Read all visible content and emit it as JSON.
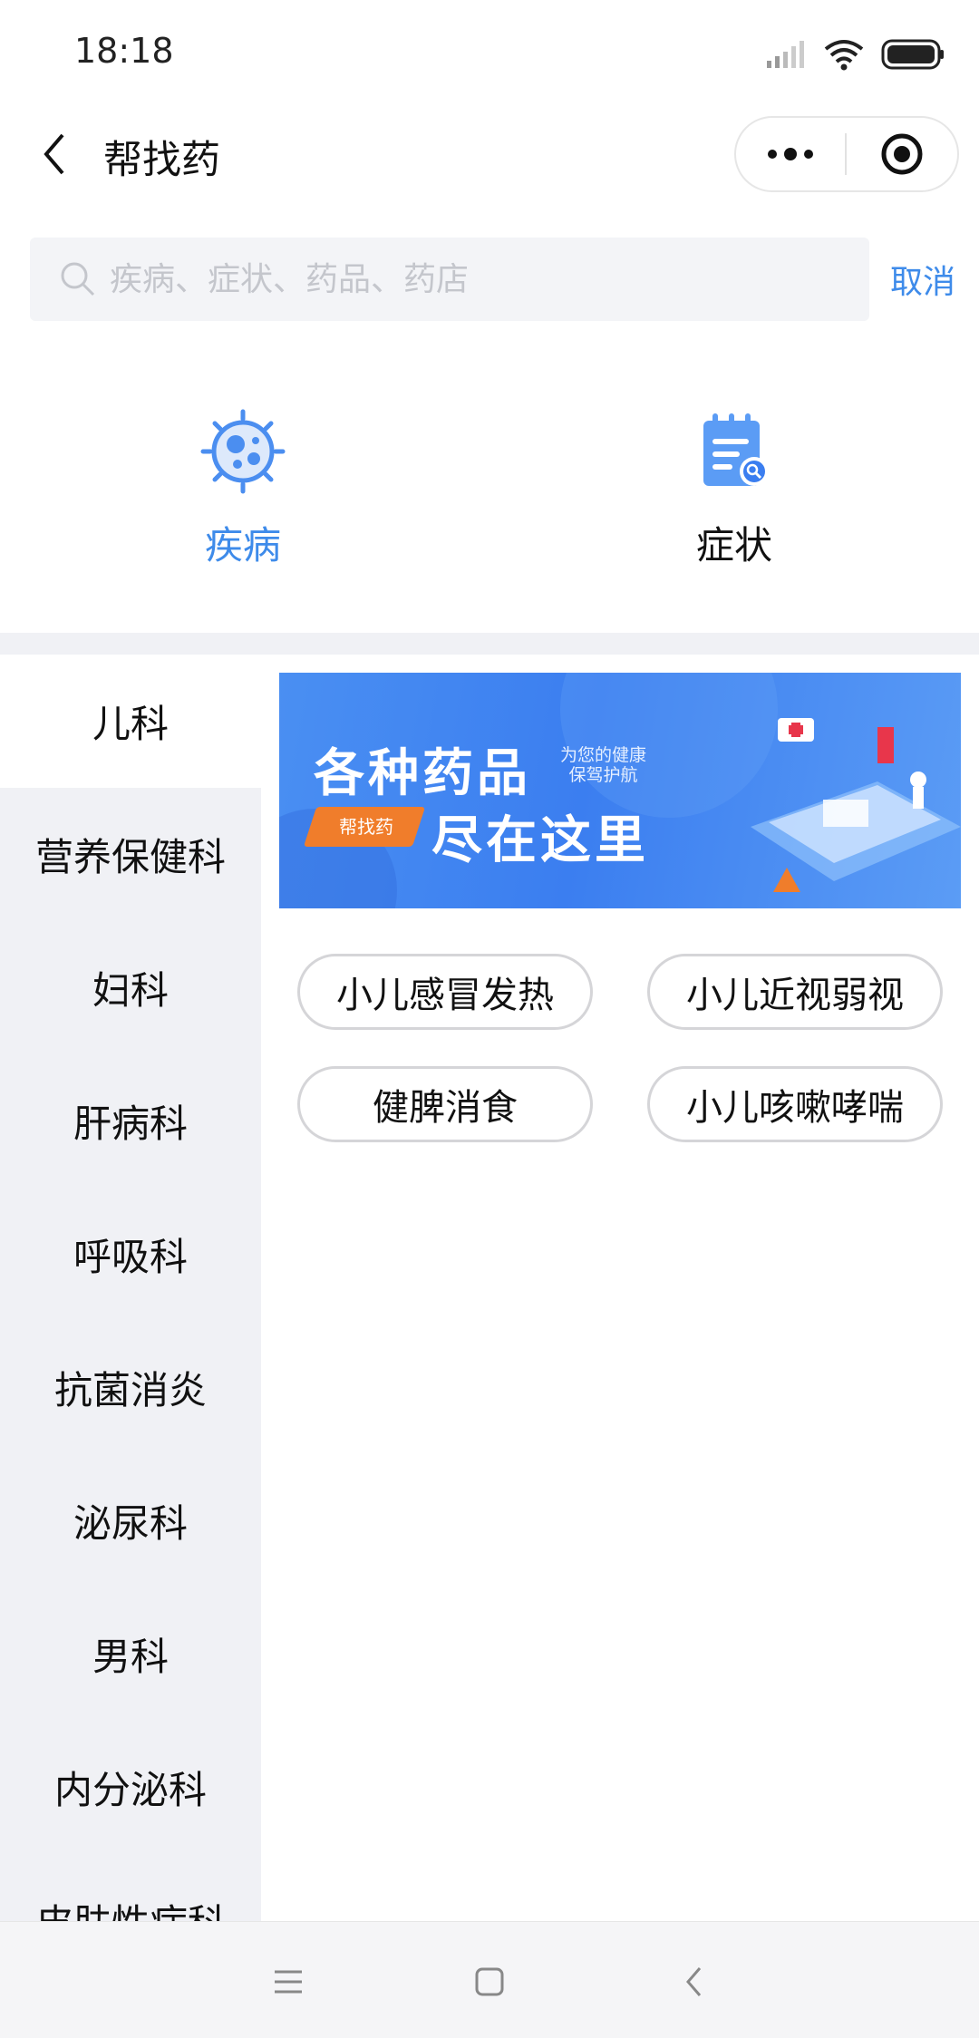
{
  "status_bar": {
    "time": "18:18"
  },
  "nav": {
    "title": "帮找药"
  },
  "search": {
    "placeholder": "疾病、症状、药品、药店",
    "value": "",
    "cancel_label": "取消"
  },
  "type_tabs": [
    {
      "label": "疾病",
      "icon": "virus-icon",
      "active": true
    },
    {
      "label": "症状",
      "icon": "search-document-icon",
      "active": false
    }
  ],
  "sidebar": {
    "items": [
      {
        "label": "儿科",
        "active": true
      },
      {
        "label": "营养保健科"
      },
      {
        "label": "妇科"
      },
      {
        "label": "肝病科"
      },
      {
        "label": "呼吸科"
      },
      {
        "label": "抗菌消炎"
      },
      {
        "label": "泌尿科"
      },
      {
        "label": "男科"
      },
      {
        "label": "内分泌科"
      },
      {
        "label": "皮肤性病科"
      }
    ]
  },
  "banner": {
    "line1": "各种药品",
    "line2": "尽在这里",
    "tag": "帮找药",
    "subtitle_1": "为您的健康",
    "subtitle_2": "保驾护航"
  },
  "chips": [
    "小儿感冒发热",
    "小儿近视弱视",
    "健脾消食",
    "小儿咳嗽哮喘"
  ],
  "colors": {
    "accent": "#3e8bea",
    "sidebar_bg": "#f0f1f5",
    "banner_blue": "#3b7ef0",
    "tag_orange": "#f07d2b"
  }
}
